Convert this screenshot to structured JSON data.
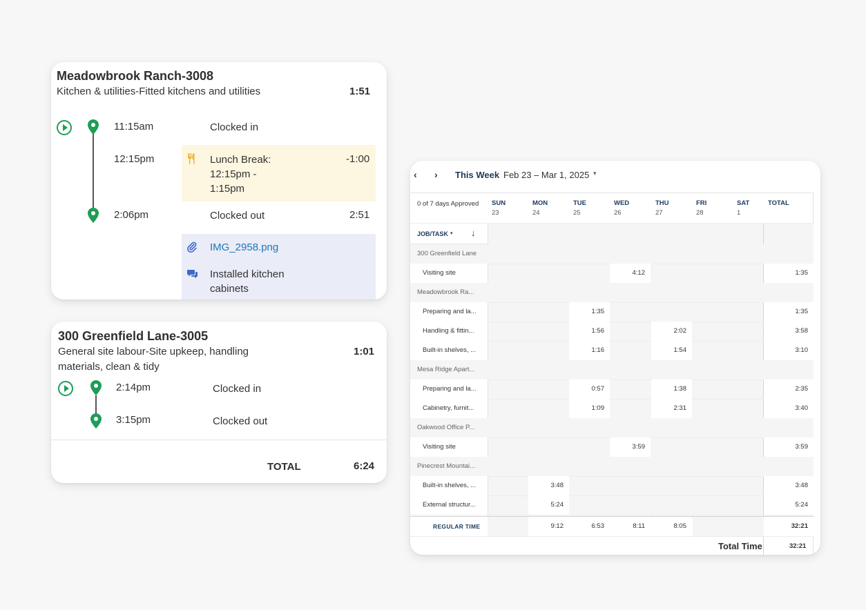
{
  "card1": {
    "title": "Meadowbrook Ranch-3008",
    "subtitle": "Kitchen & utilities-Fitted kitchens and utilities",
    "duration": "1:51",
    "entries": [
      {
        "time": "11:15am",
        "label": "Clocked in",
        "right": ""
      },
      {
        "time": "12:15pm",
        "label": "Lunch Break:\n12:15pm -\n1:15pm",
        "right": "-1:00"
      },
      {
        "time": "2:06pm",
        "label": "Clocked out",
        "right": "2:51"
      }
    ],
    "attachment": "IMG_2958.png",
    "note": "Installed kitchen\ncabinets"
  },
  "card2": {
    "title": "300 Greenfield Lane-3005",
    "subtitle": "General site labour-Site upkeep, handling\nmaterials, clean & tidy",
    "duration": "1:01",
    "entries": [
      {
        "time": "2:14pm",
        "label": "Clocked in"
      },
      {
        "time": "3:15pm",
        "label": "Clocked out"
      }
    ],
    "total_label": "TOTAL",
    "total_value": "6:24"
  },
  "timesheet": {
    "week_label": "This Week",
    "date_range": "Feb 23 – Mar 1, 2025",
    "approved": "0 of 7 days Approved",
    "days": [
      {
        "name": "SUN",
        "num": "23"
      },
      {
        "name": "MON",
        "num": "24"
      },
      {
        "name": "TUE",
        "num": "25"
      },
      {
        "name": "WED",
        "num": "26"
      },
      {
        "name": "THU",
        "num": "27"
      },
      {
        "name": "FRI",
        "num": "28"
      },
      {
        "name": "SAT",
        "num": "1"
      }
    ],
    "total_header": "TOTAL",
    "job_task_label": "JOB/TASK",
    "rows": [
      {
        "type": "group",
        "name": "300 Greenfield Lane"
      },
      {
        "type": "task",
        "name": "Visiting site",
        "values": [
          "",
          "",
          "",
          "4:12",
          "",
          "",
          ""
        ],
        "total": "1:35"
      },
      {
        "type": "group",
        "name": "Meadowbrook Ra..."
      },
      {
        "type": "task",
        "name": "Preparing and la...",
        "values": [
          "",
          "",
          "1:35",
          "",
          "",
          "",
          ""
        ],
        "total": "1:35"
      },
      {
        "type": "task",
        "name": "Handling & fittin...",
        "values": [
          "",
          "",
          "1:56",
          "",
          "2:02",
          "",
          ""
        ],
        "total": "3:58"
      },
      {
        "type": "task",
        "name": "Built-in shelves, ...",
        "values": [
          "",
          "",
          "1:16",
          "",
          "1:54",
          "",
          ""
        ],
        "total": "3:10"
      },
      {
        "type": "group",
        "name": "Mesa Ridge Apart..."
      },
      {
        "type": "task",
        "name": "Preparing and la...",
        "values": [
          "",
          "",
          "0:57",
          "",
          "1:38",
          "",
          ""
        ],
        "total": "2:35"
      },
      {
        "type": "task",
        "name": "Cabinetry, furnit...",
        "values": [
          "",
          "",
          "1:09",
          "",
          "2:31",
          "",
          ""
        ],
        "total": "3:40"
      },
      {
        "type": "group",
        "name": "Oakwood Office P..."
      },
      {
        "type": "task",
        "name": "Visiting site",
        "values": [
          "",
          "",
          "",
          "3:59",
          "",
          "",
          ""
        ],
        "total": "3:59"
      },
      {
        "type": "group",
        "name": "Pinecrest Mountai..."
      },
      {
        "type": "task",
        "name": "Built-in shelves, ...",
        "values": [
          "",
          "3:48",
          "",
          "",
          "",
          "",
          ""
        ],
        "total": "3:48"
      },
      {
        "type": "task",
        "name": "External structur...",
        "values": [
          "",
          "5:24",
          "",
          "",
          "",
          "",
          ""
        ],
        "total": "5:24"
      }
    ],
    "regular_time_label": "REGULAR TIME",
    "regular_time": [
      "",
      "9:12",
      "6:53",
      "8:11",
      "8:05",
      "",
      ""
    ],
    "regular_total": "32:21",
    "total_time_label": "Total Time",
    "total_time": "32:21"
  },
  "colors": {
    "accent_green": "#1f9d57",
    "lunch_bg": "#fdf6e1",
    "notes_bg": "#eaecf8",
    "link": "#1f76b5",
    "navy": "#1d3a5c"
  }
}
